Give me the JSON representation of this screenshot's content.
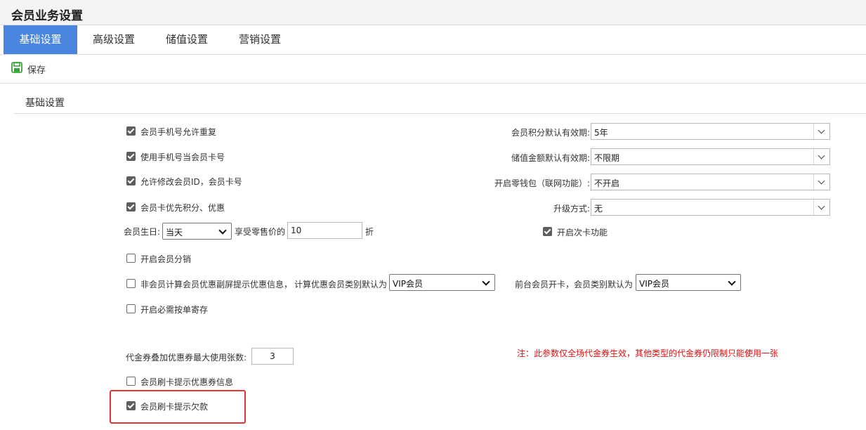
{
  "window": {
    "title": "会员业务设置"
  },
  "tabs": [
    {
      "label": "基础设置",
      "active": true
    },
    {
      "label": "高级设置",
      "active": false
    },
    {
      "label": "储值设置",
      "active": false
    },
    {
      "label": "营销设置",
      "active": false
    }
  ],
  "toolbar": {
    "save_label": "保存",
    "save_icon": "save-icon"
  },
  "section": {
    "title": "基础设置"
  },
  "left_options": [
    {
      "label": "会员手机号允许重复",
      "checked": true
    },
    {
      "label": "使用手机号当会员卡号",
      "checked": true
    },
    {
      "label": "允许修改会员ID，会员卡号",
      "checked": true
    },
    {
      "label": "会员卡优先积分、优惠",
      "checked": true
    }
  ],
  "birthday": {
    "label": "会员生日:",
    "select_value": "当天",
    "discount_label": "享受零售价的",
    "discount_value": "10",
    "unit": "折"
  },
  "right_settings": [
    {
      "label": "会员积分默认有效期:",
      "value": "5年"
    },
    {
      "label": "储值金额默认有效期:",
      "value": "不限期"
    },
    {
      "label": "开启零钱包（联网功能）:",
      "value": "不开启"
    },
    {
      "label": "升级方式:",
      "value": "无"
    }
  ],
  "second_card": {
    "label": "开启次卡功能",
    "checked": true
  },
  "distribution": {
    "label": "开启会员分销",
    "checked": false
  },
  "non_member": {
    "label": "非会员计算会员优惠副屏提示优惠信息，",
    "checked": false,
    "category_label": "计算优惠会员类别默认为",
    "category_value": "VIP会员",
    "frontdesk_label": "前台会员开卡，会员类别默认为",
    "frontdesk_value": "VIP会员"
  },
  "order_storage": {
    "label": "开启必需按单寄存",
    "checked": false
  },
  "coupon": {
    "label": "代金券叠加优惠券最大使用张数:",
    "value": "3",
    "note": "注：此参数仅全场代金券生效，其他类型的代金券仍限制只能使用一张"
  },
  "swipe_coupon": {
    "label": "会员刷卡提示优惠券信息",
    "checked": false
  },
  "swipe_debt": {
    "label": "会员刷卡提示欠款",
    "checked": true
  },
  "colors": {
    "accent": "#4a86e0",
    "note": "#e01010",
    "highlight": "#e53535"
  }
}
